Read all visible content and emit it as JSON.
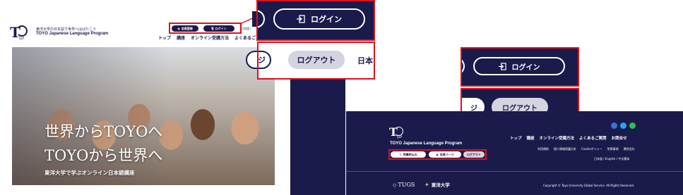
{
  "left_site": {
    "logo_text": "T",
    "logo_sub": "TJLP",
    "tagline": "東洋大学の日本語で世界へはばたこう",
    "program_name": "TOYO Japanese Language Program",
    "header_buttons": {
      "register": "会員登録",
      "login": "ログイン"
    },
    "lang_hint": "日本語 /",
    "nav": [
      "トップ",
      "講座",
      "オンライン受講方法",
      "よくあるご"
    ],
    "hero": {
      "line1": "世界からTOYOへ",
      "line2": "TOYOから世界へ",
      "subtitle": "東洋大学で学ぶオンライン日本語講座"
    }
  },
  "zoom_top": {
    "login_label": "ログイン",
    "logout_label": "ログアウト",
    "lang_partial": "日本",
    "partial_char": "ジ"
  },
  "right_zoom": {
    "login_label": "ログイン",
    "logout_label": "ログアウト",
    "partial_char": "ジ"
  },
  "footer": {
    "logo_sub": "TJLP",
    "program_name": "TOYO Japanese Language Program",
    "nav": [
      "トップ",
      "講座",
      "オンライン受講方法",
      "よくあるご質問",
      "お問合せ"
    ],
    "links": [
      "利用規約",
      "個人情報保護方針",
      "Cookieポリシー",
      "免責事項",
      "運営会社"
    ],
    "lang_switch": "日本語 / English / 中文簡体",
    "buttons": {
      "apply": "受講申込み",
      "mypage": "会員ページ",
      "logout": "ログアウト"
    },
    "brand_tugs": "TUGS",
    "brand_toyo": "東洋大学",
    "copyright": "Copyright © Toyo University Global Service. All Rights Reserved."
  },
  "colors": {
    "navy": "#1a1b4b",
    "highlight_red": "#e0101c",
    "pill_gray": "#d4d4e0"
  },
  "icons": [
    "login-door-icon",
    "user-icon",
    "facebook-icon",
    "twitter-icon",
    "line-icon",
    "pencil-icon"
  ]
}
